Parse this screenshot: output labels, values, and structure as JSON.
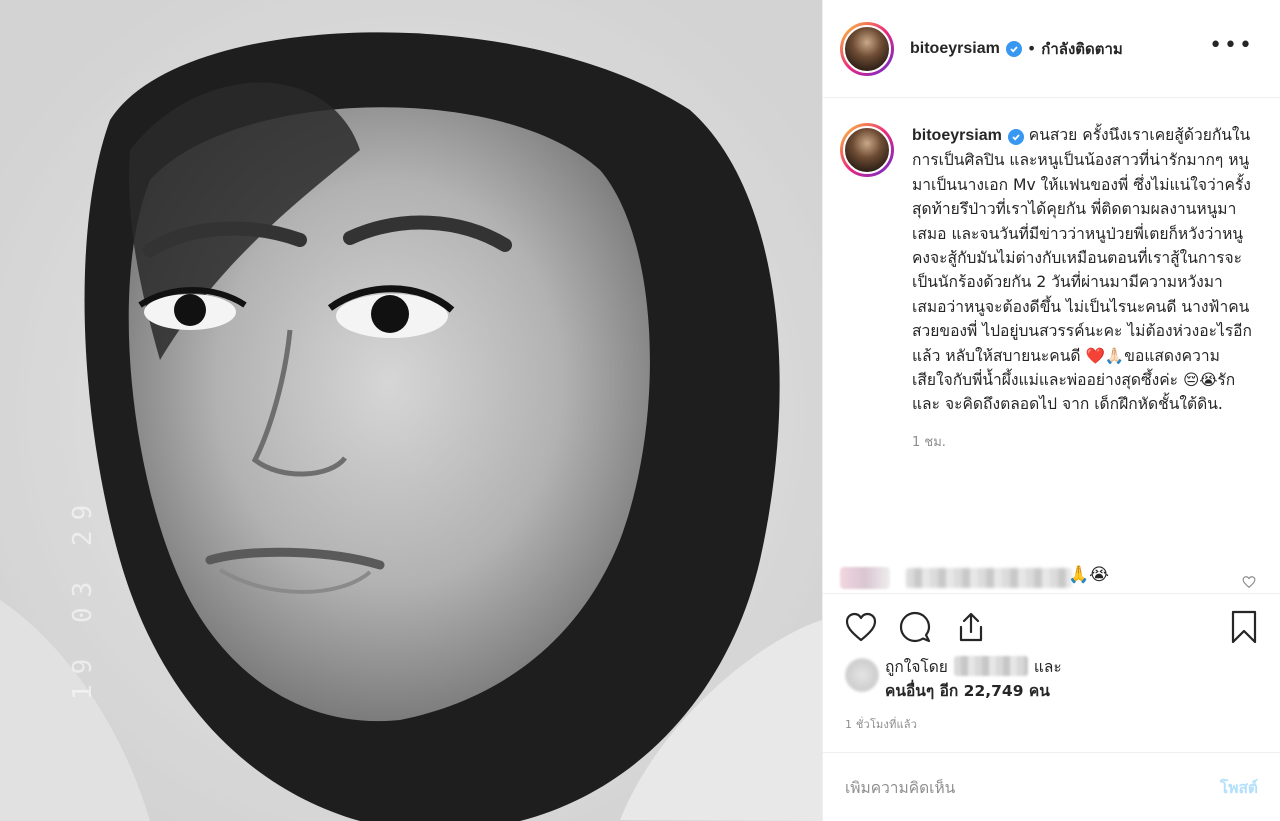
{
  "photo": {
    "alt_icon": "photo-portrait",
    "stamp": "19 03 29"
  },
  "header": {
    "username": "bitoeyrsiam",
    "separator": "•",
    "follow_status": "กำลังติดตาม",
    "more_label": "•••"
  },
  "caption": {
    "username": "bitoeyrsiam",
    "text": "คนสวย ครั้งนึงเราเคยสู้ด้วยกันในการเป็นศิลปิน และหนูเป็นน้องสาวที่น่ารักมากๆ หนูมาเป็นนางเอก Mv ให้แฟนของพี่ ซึ่งไม่แน่ใจว่าครั้งสุดท้ายรึป่าวที่เราได้คุยกัน พี่ติดตามผลงานหนูมาเสมอ และจนวันที่มีข่าวว่าหนูป่วยพี่เตยก็หวังว่าหนูคงจะสู้กับมันไม่ต่างกับเหมือนตอนที่เราสู้ในการจะเป็นนักร้องด้วยกัน 2 วันที่ผ่านมามีความหวังมาเสมอว่าหนูจะต้องดีขึ้น ไม่เป็นไรนะคนดี นางฟ้าคนสวยของพี่ ไปอยู่บนสวรรค์นะคะ ไม่ต้องห่วงอะไรอีกแล้ว หลับให้สบายนะคนดี ❤️🙏🏻ขอแสดงความเสียใจกับพี่น้ำผึ้งแม่และพ่ออย่างสุดซึ้งค่ะ 😔😭รัก และ จะคิดถึงตลอดไป จาก เด็กฝึกหัดชั้นใต้ดิน.",
    "time": "1 ชม."
  },
  "partial_comment": {
    "emoji": "🙏😭"
  },
  "likes": {
    "prefix": "ถูกใจโดย",
    "conjunction": "และ",
    "others": "คนอื่นๆ อีก 22,749 คน"
  },
  "post_time": "1 ชั่วโมงที่แล้ว",
  "comment_box": {
    "placeholder": "เพิ่มความคิดเห็น",
    "post_label": "โพสต์"
  },
  "colors": {
    "verified": "#3897f0",
    "post_button": "#b2dffc",
    "muted": "#8e8e8e"
  }
}
